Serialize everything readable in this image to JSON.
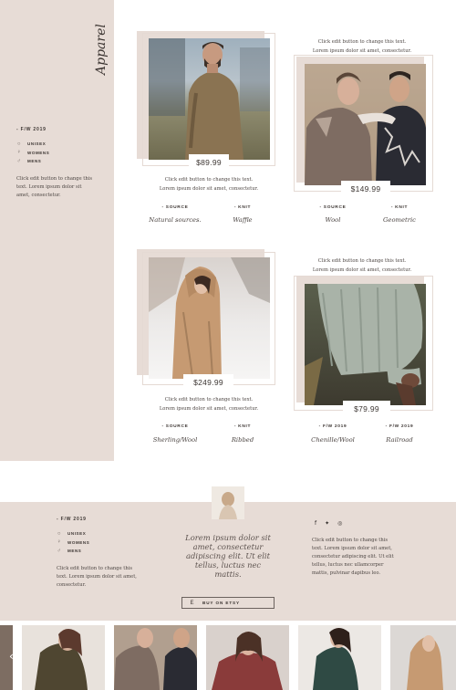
{
  "sidebar": {
    "vertical_title": "Apparel",
    "season": "- F/W 2019",
    "categories": [
      {
        "label": "UNISEX",
        "icon": "gender-neutral-icon"
      },
      {
        "label": "WOMENS",
        "icon": "female-icon"
      },
      {
        "label": "MENS",
        "icon": "male-icon"
      }
    ],
    "text": "Click edit button to change this text. Lorem ipsum dolor sit amet, consectetur."
  },
  "products": [
    {
      "price": "$89.99",
      "caption_line1": "Click edit button to change this text.",
      "caption_line2": "Lorem ipsum dolor sit amet, consectetur.",
      "attr1_label": "- SOURCE",
      "attr1_value": "Natural sources.",
      "attr2_label": "- KNIT",
      "attr2_value": "Waffle"
    },
    {
      "price": "$149.99",
      "caption_line1": "Click edit button to change this text.",
      "caption_line2": "Lorem ipsum dolor sit amet, consectetur.",
      "attr1_label": "- SOURCE",
      "attr1_value": "Wool",
      "attr2_label": "- KNIT",
      "attr2_value": "Geometric"
    },
    {
      "price": "$249.99",
      "caption_line1": "Click edit button to change this text.",
      "caption_line2": "Lorem ipsum dolor sit amet, consectetur.",
      "attr1_label": "- SOURCE",
      "attr1_value": "Sherling/Wool",
      "attr2_label": "- KNIT",
      "attr2_value": "Ribbed"
    },
    {
      "price": "$79.99",
      "caption_line1": "Click edit button to change this text.",
      "caption_line2": "Lorem ipsum dolor sit amet, consectetur.",
      "attr1_label": "- F/W 2019",
      "attr1_value": "Chenille/Wool",
      "attr2_label": "- F/W 2019",
      "attr2_value": "Railroad"
    }
  ],
  "footer": {
    "season": "- F/W 2019",
    "categories": [
      {
        "label": "UNISEX",
        "icon": "gender-neutral-icon"
      },
      {
        "label": "WOMENS",
        "icon": "female-icon"
      },
      {
        "label": "MENS",
        "icon": "male-icon"
      }
    ],
    "left_text": "Click edit button to change this text. Lorem ipsum dolor sit amet, consectetur.",
    "quote": "Lorem ipsum dolor sit amet, consectetur adipiscing elit. Ut elit tellus, luctus nec mattis.",
    "buy_icon": "E",
    "buy_label": "BUY ON ETSY",
    "social": [
      "f",
      "✦",
      "◎"
    ],
    "right_text": "Click edit button to change this text. Lorem ipsum dolor sit amet, consectetur adipiscing elit. Ut elit tellus, luctus nec ullamcorper mattis, pulvinar dapibus leo."
  },
  "carousel": {
    "prev_icon": "‹"
  },
  "colors": {
    "beige": "#e7dcd6",
    "frame": "#e5dad4",
    "text_dark": "#3c3532"
  }
}
